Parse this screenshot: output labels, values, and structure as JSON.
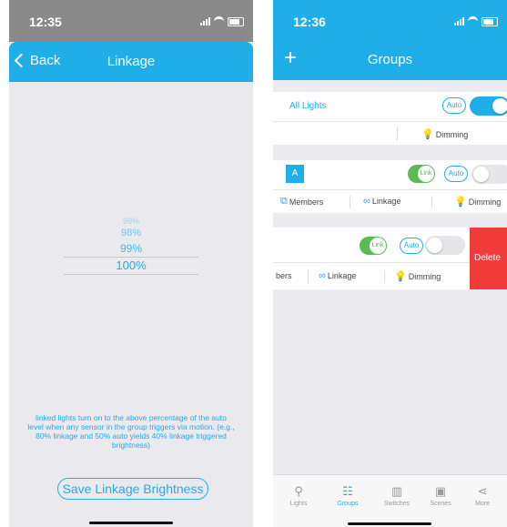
{
  "left": {
    "status": {
      "time": "12:35"
    },
    "nav": {
      "back": "Back",
      "title": "Linkage"
    },
    "picker": {
      "p1": "99%",
      "p2": "98%",
      "p3": "99%",
      "selected": "100%"
    },
    "note": "linked lights turn on to the above percentage of the auto level when any sensor in the group triggers via motion. (e.g., 80% linkage and 50% auto yields 40% linkage triggered brightness)",
    "save": "Save Linkage Brightness"
  },
  "right": {
    "status": {
      "time": "12:36"
    },
    "nav": {
      "title": "Groups",
      "plus": "+"
    },
    "all_lights": {
      "label": "All Lights",
      "auto": "Auto",
      "toggle_on": true,
      "dimming": "Dimming"
    },
    "group_a": {
      "badge": "A",
      "link": "Link",
      "auto": "Auto",
      "toggle_on": false,
      "members": "Members",
      "linkage": "Linkage",
      "dimming": "Dimming"
    },
    "group_b": {
      "link": "Link",
      "auto": "Auto",
      "toggle_on": false,
      "members": "bers",
      "linkage": "Linkage",
      "dimming": "Dimming",
      "delete": "Delete"
    },
    "tabs": [
      {
        "label": "Lights",
        "icon": "bulb-icon"
      },
      {
        "label": "Groups",
        "icon": "groups-icon"
      },
      {
        "label": "Switches",
        "icon": "switches-icon"
      },
      {
        "label": "Scenes",
        "icon": "scenes-icon"
      },
      {
        "label": "More",
        "icon": "share-icon"
      }
    ],
    "active_tab": "Groups"
  },
  "colors": {
    "accent": "#1faee8",
    "link_green": "#5cba55",
    "delete_red": "#f23b3b",
    "gray_status": "#8a8a8a"
  }
}
